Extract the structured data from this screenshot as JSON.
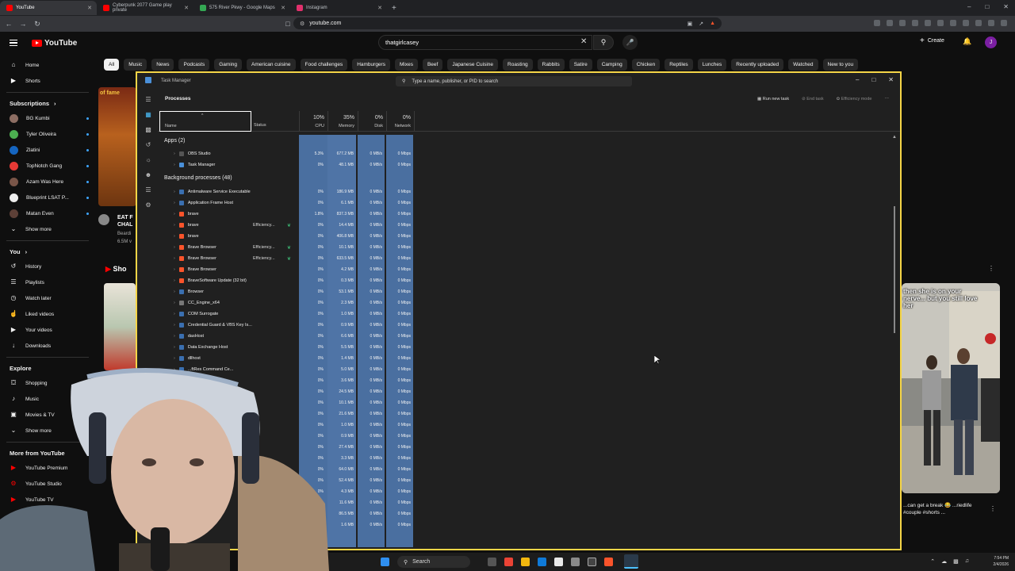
{
  "browser": {
    "tabs": [
      {
        "label": "YouTube",
        "active": true,
        "color": "#ff0000"
      },
      {
        "label": "Cyberpunk 2077 Game play private",
        "active": false,
        "color": "#ff0000"
      },
      {
        "label": "575 River Pkwy - Google Maps",
        "active": false,
        "color": "#34a853"
      },
      {
        "label": "Instagram",
        "active": false,
        "color": "#e1306c"
      }
    ],
    "url": "youtube.com"
  },
  "youtube": {
    "logo": "YouTube",
    "search_value": "thatgirlcasey",
    "create_label": "Create",
    "avatar_letter": "J",
    "chips": [
      "All",
      "Music",
      "News",
      "Podcasts",
      "Gaming",
      "American cuisine",
      "Food challenges",
      "Hamburgers",
      "Mixes",
      "Beef",
      "Japanese Cuisine",
      "Roasting",
      "Rabbits",
      "Satire",
      "Camping",
      "Chicken",
      "Reptiles",
      "Lunches",
      "Recently uploaded",
      "Watched",
      "New to you"
    ],
    "sidebar": {
      "home": "Home",
      "shorts": "Shorts",
      "subscriptions": "Subscriptions",
      "subs": [
        {
          "name": "BG Kumbi",
          "color": "#8d6e63"
        },
        {
          "name": "Tyler Oliveira",
          "color": "#4caf50"
        },
        {
          "name": "Zlatini",
          "color": "#1565c0"
        },
        {
          "name": "TopNotch Gang",
          "color": "#e53935"
        },
        {
          "name": "Azam Was Here",
          "color": "#795548"
        },
        {
          "name": "Blueprint LSAT P...",
          "color": "#eeeeee"
        },
        {
          "name": "Matan Even",
          "color": "#5d4037"
        }
      ],
      "show_more": "Show more",
      "you": "You",
      "you_items": [
        "History",
        "Playlists",
        "Watch later",
        "Liked videos",
        "Your videos",
        "Downloads"
      ],
      "explore": "Explore",
      "explore_items": [
        "Shopping",
        "Music",
        "Movies & TV"
      ],
      "show_more_2": "Show more",
      "more_from": "More from YouTube",
      "more_items": [
        "YouTube Premium",
        "YouTube Studio",
        "YouTube TV"
      ]
    },
    "feed": {
      "video_title": "EAT F CHAL",
      "channel": "Beardi",
      "views": "6.5M v",
      "shorts_label": "Sho",
      "thumb_label": "of fame"
    },
    "short": {
      "caption": "then she is on your nerve... but you still love her",
      "title": "...can get a break 😂 ...riedlife #couple #shorts ..."
    }
  },
  "taskmanager": {
    "title": "Task Manager",
    "search_placeholder": "Type a name, publisher, or PID to search",
    "section": "Processes",
    "actions": {
      "run": "Run new task",
      "end": "End task",
      "efficiency": "Efficiency mode"
    },
    "columns": {
      "name": "Name",
      "status": "Status",
      "cpu_pct": "10%",
      "cpu": "CPU",
      "mem_pct": "35%",
      "mem": "Memory",
      "disk_pct": "0%",
      "disk": "Disk",
      "net_pct": "0%",
      "net": "Network"
    },
    "apps_group": "Apps (2)",
    "apps": [
      {
        "name": "OBS Studio",
        "status": "",
        "cpu": "5.3%",
        "mem": "677.2 MB",
        "disk": "0 MB/s",
        "net": "0 Mbps",
        "color": "#555"
      },
      {
        "name": "Task Manager",
        "status": "",
        "cpu": "0%",
        "mem": "48.1 MB",
        "disk": "0 MB/s",
        "net": "0 Mbps",
        "color": "#4a90d9"
      }
    ],
    "bg_group": "Background processes (48)",
    "processes": [
      {
        "name": "Antimalware Service Executable",
        "status": "",
        "cpu": "0%",
        "mem": "186.9 MB",
        "color": "#3a6fb0"
      },
      {
        "name": "Application Frame Host",
        "status": "",
        "cpu": "0%",
        "mem": "6.1 MB",
        "color": "#3a6fb0"
      },
      {
        "name": "brave",
        "status": "",
        "cpu": "1.8%",
        "mem": "837.3 MB",
        "color": "#fb542b"
      },
      {
        "name": "brave",
        "status": "Efficiency...",
        "cpu": "0%",
        "mem": "14.4 MB",
        "color": "#fb542b"
      },
      {
        "name": "brave",
        "status": "",
        "cpu": "0%",
        "mem": "406.8 MB",
        "color": "#fb542b"
      },
      {
        "name": "Brave Browser",
        "status": "Efficiency...",
        "cpu": "0%",
        "mem": "10.1 MB",
        "color": "#fb542b"
      },
      {
        "name": "Brave Browser",
        "status": "Efficiency...",
        "cpu": "0%",
        "mem": "633.5 MB",
        "color": "#fb542b"
      },
      {
        "name": "Brave Browser",
        "status": "",
        "cpu": "0%",
        "mem": "4.2 MB",
        "color": "#fb542b"
      },
      {
        "name": "BraveSoftware Update (32 bit)",
        "status": "",
        "cpu": "0%",
        "mem": "0.3 MB",
        "color": "#fb542b"
      },
      {
        "name": "Browser",
        "status": "",
        "cpu": "0%",
        "mem": "53.1 MB",
        "color": "#3a6fb0"
      },
      {
        "name": "CC_Engine_x64",
        "status": "",
        "cpu": "0%",
        "mem": "2.3 MB",
        "color": "#777"
      },
      {
        "name": "COM Surrogate",
        "status": "",
        "cpu": "0%",
        "mem": "1.0 MB",
        "color": "#3a6fb0"
      },
      {
        "name": "Credential Guard & VBS Key Is...",
        "status": "",
        "cpu": "0%",
        "mem": "0.9 MB",
        "color": "#3a6fb0"
      },
      {
        "name": "dasHost",
        "status": "",
        "cpu": "0%",
        "mem": "6.6 MB",
        "color": "#3a6fb0"
      },
      {
        "name": "Data Exchange Host",
        "status": "",
        "cpu": "0%",
        "mem": "5.5 MB",
        "color": "#3a6fb0"
      },
      {
        "name": "dllhost",
        "status": "",
        "cpu": "0%",
        "mem": "1.4 MB",
        "color": "#3a6fb0"
      },
      {
        "name": "...ftRes Command Ce...",
        "status": "",
        "cpu": "0%",
        "mem": "5.0 MB",
        "color": "#3a6fb0"
      },
      {
        "name": "...ere Servi...",
        "status": "",
        "cpu": "0%",
        "mem": "3.6 MB",
        "color": "#3a6fb0"
      },
      {
        "name": "",
        "status": "",
        "cpu": "0%",
        "mem": "24.5 MB",
        "color": "#3a6fb0"
      },
      {
        "name": "",
        "status": "",
        "cpu": "0%",
        "mem": "10.1 MB",
        "color": "#3a6fb0"
      },
      {
        "name": "",
        "status": "",
        "cpu": "0%",
        "mem": "21.6 MB",
        "color": "#3a6fb0"
      },
      {
        "name": "",
        "status": "",
        "cpu": "0%",
        "mem": "1.0 MB",
        "color": "#3a6fb0"
      },
      {
        "name": "",
        "status": "",
        "cpu": "0%",
        "mem": "0.9 MB",
        "color": "#3a6fb0"
      },
      {
        "name": "",
        "status": "",
        "cpu": "0%",
        "mem": "27.4 MB",
        "color": "#3a6fb0"
      },
      {
        "name": "",
        "status": "",
        "cpu": "0%",
        "mem": "3.3 MB",
        "color": "#3a6fb0"
      },
      {
        "name": "",
        "status": "",
        "cpu": "0%",
        "mem": "64.0 MB",
        "color": "#3a6fb0"
      },
      {
        "name": "",
        "status": "",
        "cpu": "0%",
        "mem": "52.4 MB",
        "color": "#3a6fb0"
      },
      {
        "name": "",
        "status": "",
        "cpu": "0%",
        "mem": "4.3 MB",
        "color": "#3a6fb0"
      },
      {
        "name": "",
        "status": "",
        "cpu": "0%",
        "mem": "11.6 MB",
        "color": "#3a6fb0"
      },
      {
        "name": "",
        "status": "",
        "cpu": "0%",
        "mem": "86.5 MB",
        "color": "#3a6fb0"
      },
      {
        "name": "",
        "status": "",
        "cpu": "0%",
        "mem": "1.6 MB",
        "color": "#3a6fb0"
      }
    ],
    "disk_value": "0 MB/s",
    "net_value": "0 Mbps"
  },
  "taskbar": {
    "search": "Search",
    "time": "7:54 PM",
    "date": "2/4/2026"
  }
}
